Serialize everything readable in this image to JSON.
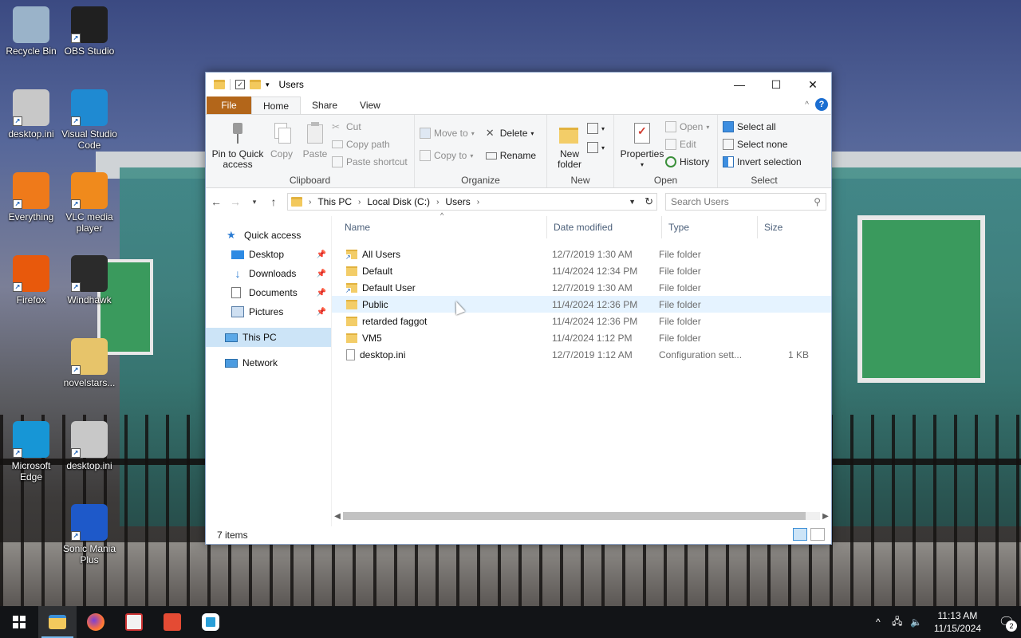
{
  "desktop": {
    "icons": [
      {
        "label": "Recycle Bin",
        "icon": "recycle-bin-icon",
        "color": "#9ab3c9"
      },
      {
        "label": "OBS Studio",
        "icon": "obs-studio-icon",
        "color": "#202020"
      },
      {
        "label": "desktop.ini",
        "icon": "settings-file-icon",
        "color": "#c8c8c8"
      },
      {
        "label": "Visual Studio Code",
        "icon": "vscode-icon",
        "color": "#1f8ad2"
      },
      {
        "label": "Everything",
        "icon": "search-magnifier-icon",
        "color": "#ef7a1a"
      },
      {
        "label": "VLC media player",
        "icon": "vlc-cone-icon",
        "color": "#f08a1c"
      },
      {
        "label": "Firefox",
        "icon": "firefox-icon",
        "color": "#e8590c"
      },
      {
        "label": "Windhawk",
        "icon": "windhawk-icon",
        "color": "#2b2b2b"
      },
      {
        "label": "novelstars...",
        "icon": "folder-zip-icon",
        "color": "#e7c46a"
      },
      {
        "label": "Microsoft Edge",
        "icon": "edge-icon",
        "color": "#1796d6"
      },
      {
        "label": "desktop.ini",
        "icon": "settings-file-icon",
        "color": "#c8c8c8"
      },
      {
        "label": "Sonic Mania Plus",
        "icon": "sonic-game-icon",
        "color": "#1e59c9"
      }
    ]
  },
  "window": {
    "title": "Users",
    "controls": {
      "minimize": "—",
      "maximize": "☐",
      "close": "✕"
    },
    "tabs": {
      "file": "File",
      "home": "Home",
      "share": "Share",
      "view": "View"
    },
    "help": "?",
    "ribbon": {
      "clipboard": {
        "label": "Clipboard",
        "pin": "Pin to Quick access",
        "copy": "Copy",
        "paste": "Paste",
        "cut": "Cut",
        "copy_path": "Copy path",
        "paste_shortcut": "Paste shortcut"
      },
      "organize": {
        "label": "Organize",
        "move_to": "Move to",
        "copy_to": "Copy to",
        "delete": "Delete",
        "rename": "Rename"
      },
      "new": {
        "label": "New",
        "new_folder": "New folder"
      },
      "open": {
        "label": "Open",
        "properties": "Properties",
        "open": "Open",
        "edit": "Edit",
        "history": "History"
      },
      "select": {
        "label": "Select",
        "select_all": "Select all",
        "select_none": "Select none",
        "invert": "Invert selection"
      }
    },
    "address": {
      "crumbs": [
        "This PC",
        "Local Disk (C:)",
        "Users"
      ],
      "search_placeholder": "Search Users"
    },
    "nav": {
      "quick_access": "Quick access",
      "items": [
        "Desktop",
        "Downloads",
        "Documents",
        "Pictures"
      ],
      "this_pc": "This PC",
      "network": "Network"
    },
    "columns": {
      "name": "Name",
      "date": "Date modified",
      "type": "Type",
      "size": "Size"
    },
    "rows": [
      {
        "name": "All Users",
        "date": "12/7/2019 1:30 AM",
        "type": "File folder",
        "size": "",
        "kind": "folder-link"
      },
      {
        "name": "Default",
        "date": "11/4/2024 12:34 PM",
        "type": "File folder",
        "size": "",
        "kind": "folder"
      },
      {
        "name": "Default User",
        "date": "12/7/2019 1:30 AM",
        "type": "File folder",
        "size": "",
        "kind": "folder-link"
      },
      {
        "name": "Public",
        "date": "11/4/2024 12:36 PM",
        "type": "File folder",
        "size": "",
        "kind": "folder"
      },
      {
        "name": "retarded faggot",
        "date": "11/4/2024 12:36 PM",
        "type": "File folder",
        "size": "",
        "kind": "folder"
      },
      {
        "name": "VM5",
        "date": "11/4/2024 1:12 PM",
        "type": "File folder",
        "size": "",
        "kind": "folder"
      },
      {
        "name": "desktop.ini",
        "date": "12/7/2019 1:12 AM",
        "type": "Configuration sett...",
        "size": "1 KB",
        "kind": "file"
      }
    ],
    "status": "7 items"
  },
  "taskbar": {
    "apps": [
      "start-icon",
      "file-explorer-icon",
      "firefox-icon",
      "notepad-plus-icon",
      "git-icon",
      "app-ring-icon"
    ],
    "time": "11:13 AM",
    "date": "11/15/2024",
    "notification_count": "2"
  }
}
